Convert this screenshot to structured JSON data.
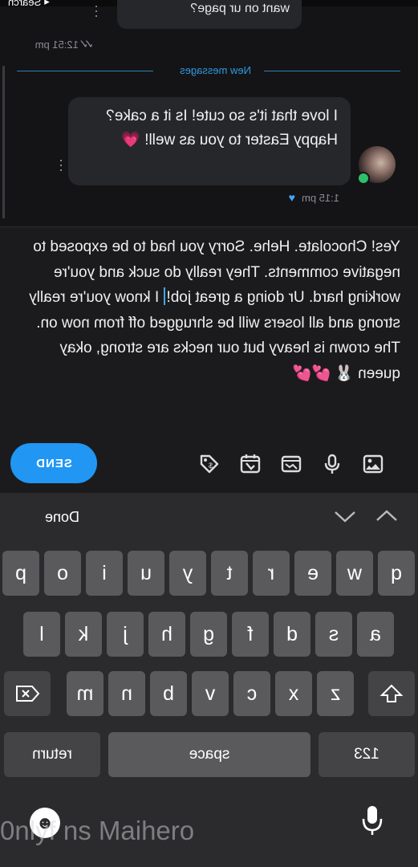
{
  "status": {
    "search_label": "Search"
  },
  "previous_message": {
    "text": "want on ur page?",
    "time": "12:51 pm"
  },
  "divider": {
    "label": "New messages"
  },
  "incoming_message": {
    "text": "I love that it's so cute! Is it a cake? Happy Easter to you as well! 💗",
    "time": "1:15 pm"
  },
  "compose": {
    "text_before_cursor": "Yes! Chocolate. Hehe. Sorry you had to be exposed to negative comments. They really do suck and you're working hard. Ur doing a great job!",
    "text_after_cursor": " I know you're really strong and all losers will be shrugged off from now on. The crown is heavy but our necks are strong, okay queen 🐰 💕💕",
    "send_label": "SEND"
  },
  "keyboard": {
    "done_label": "Done",
    "row1": [
      "q",
      "w",
      "e",
      "r",
      "t",
      "y",
      "u",
      "i",
      "o",
      "p"
    ],
    "row2": [
      "a",
      "s",
      "d",
      "f",
      "g",
      "h",
      "j",
      "k",
      "l"
    ],
    "row3": [
      "z",
      "x",
      "c",
      "v",
      "b",
      "n",
      "m"
    ],
    "numbers_label": "123",
    "space_label": "space",
    "return_label": "return"
  },
  "watermark": "0nlyf ns Maihero",
  "colors": {
    "accent": "#2196f3",
    "online": "#2fbf6a",
    "background": "#141416"
  }
}
